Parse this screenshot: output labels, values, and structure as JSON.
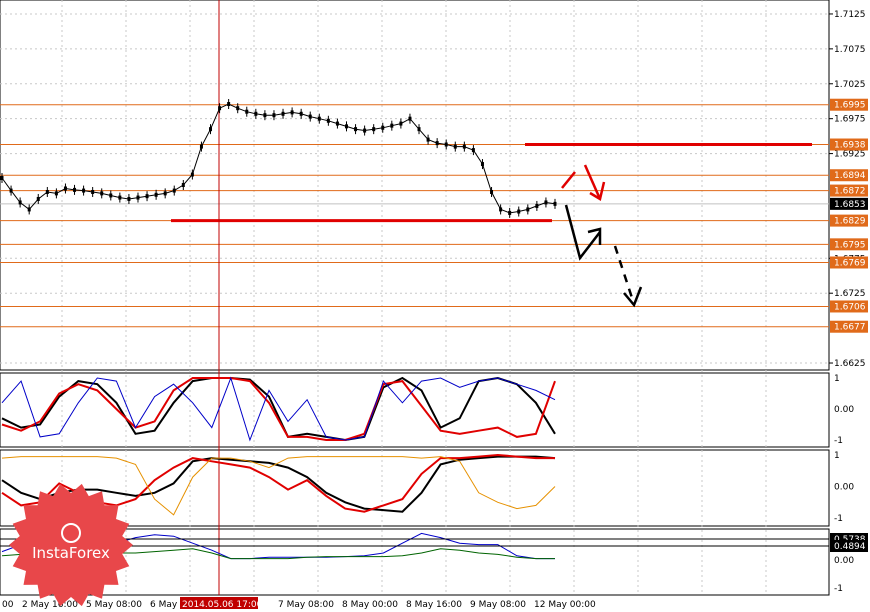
{
  "chart_data": {
    "type": "line",
    "instrument_chart": {
      "price_ticks": [
        "1.7125",
        "1.7075",
        "1.7025",
        "1.6975",
        "1.6925",
        "1.6775",
        "1.6725",
        "1.6625"
      ],
      "ylim": [
        1.6615,
        1.7145
      ],
      "levels": [
        {
          "value": 1.6995,
          "label": "1.6995"
        },
        {
          "value": 1.6938,
          "label": "1.6938"
        },
        {
          "value": 1.6894,
          "label": "1.6894"
        },
        {
          "value": 1.6872,
          "label": "1.6872"
        },
        {
          "value": 1.6829,
          "label": "1.6829"
        },
        {
          "value": 1.6795,
          "label": "1.6795"
        },
        {
          "value": 1.6769,
          "label": "1.6769"
        },
        {
          "value": 1.6706,
          "label": "1.6706"
        },
        {
          "value": 1.6677,
          "label": "1.6677"
        }
      ],
      "current_price": {
        "value": 1.6853,
        "label": "1.6853"
      },
      "resistance_line": {
        "value": 1.6938
      },
      "support_line": {
        "value": 1.6829
      },
      "price_series": [
        1.689,
        1.6872,
        1.6855,
        1.6845,
        1.686,
        1.687,
        1.6868,
        1.6875,
        1.6873,
        1.6872,
        1.687,
        1.6868,
        1.6865,
        1.6862,
        1.686,
        1.6862,
        1.6864,
        1.6866,
        1.6868,
        1.6872,
        1.688,
        1.6895,
        1.6935,
        1.696,
        1.699,
        1.6996,
        1.699,
        1.6985,
        1.6982,
        1.698,
        1.698,
        1.6982,
        1.6984,
        1.6982,
        1.6978,
        1.6975,
        1.6972,
        1.6968,
        1.6964,
        1.696,
        1.6958,
        1.696,
        1.6962,
        1.6965,
        1.6968,
        1.6975,
        1.696,
        1.6945,
        1.694,
        1.6938,
        1.6935,
        1.6935,
        1.693,
        1.691,
        1.687,
        1.6845,
        1.684,
        1.6842,
        1.6845,
        1.685,
        1.6855,
        1.6853
      ]
    },
    "date_labels": [
      "00",
      "2 May 16:00",
      "5 May 08:00",
      "6 May",
      "2014.05.06 17:00",
      "7 May 08:00",
      "8 May 00:00",
      "8 May 16:00",
      "9 May 08:00",
      "12 May 00:00"
    ],
    "highlight_date": "2014.05.06 17:00",
    "indicator1": {
      "ticks": [
        "1",
        "0.00",
        "-1"
      ],
      "ylim": [
        -1,
        1
      ],
      "series": [
        {
          "color": "#000000",
          "values": [
            -0.3,
            -0.6,
            -0.5,
            0.4,
            0.9,
            0.8,
            0.2,
            -0.8,
            -0.7,
            0.2,
            0.9,
            1.0,
            1.0,
            0.95,
            0.4,
            -0.9,
            -0.8,
            -0.9,
            -1.0,
            -0.9,
            0.7,
            1.0,
            0.6,
            -0.6,
            -0.3,
            0.9,
            1.0,
            0.8,
            0.2,
            -0.8
          ]
        },
        {
          "color": "#e00000",
          "values": [
            -0.5,
            -0.7,
            -0.4,
            0.5,
            0.8,
            0.6,
            0.0,
            -0.6,
            -0.4,
            0.6,
            1.0,
            1.0,
            1.0,
            0.9,
            0.2,
            -0.9,
            -0.9,
            -1.0,
            -1.0,
            -0.8,
            0.8,
            0.9,
            0.1,
            -0.7,
            -0.8,
            -0.7,
            -0.6,
            -0.9,
            -0.8,
            0.9
          ]
        },
        {
          "color": "#0000c8",
          "values": [
            0.2,
            0.9,
            -0.9,
            -0.8,
            0.2,
            1.0,
            0.9,
            -0.6,
            0.4,
            0.8,
            0.2,
            -0.6,
            1.0,
            -1.0,
            0.6,
            -0.4,
            0.3,
            -0.9,
            -1.0,
            -0.9,
            0.9,
            0.2,
            0.9,
            1.0,
            0.7,
            0.9,
            1.0,
            0.8,
            0.6,
            0.3
          ]
        }
      ]
    },
    "indicator2": {
      "ticks": [
        "1",
        "0.00",
        "-1"
      ],
      "ylim": [
        -1,
        1
      ],
      "series": [
        {
          "color": "#000000",
          "values": [
            0.2,
            -0.2,
            -0.4,
            -0.2,
            -0.1,
            -0.1,
            -0.2,
            -0.3,
            -0.2,
            0.1,
            0.8,
            0.9,
            0.85,
            0.8,
            0.75,
            0.6,
            0.3,
            -0.2,
            -0.5,
            -0.7,
            -0.75,
            -0.8,
            -0.2,
            0.7,
            0.85,
            0.9,
            0.95,
            0.95,
            0.95,
            0.9
          ]
        },
        {
          "color": "#e00000",
          "values": [
            -0.2,
            -0.6,
            -0.5,
            0.1,
            -0.2,
            -0.5,
            -0.6,
            -0.4,
            0.2,
            0.6,
            0.9,
            0.8,
            0.7,
            0.6,
            0.3,
            -0.1,
            0.2,
            -0.3,
            -0.7,
            -0.8,
            -0.6,
            -0.4,
            0.4,
            0.9,
            0.9,
            0.95,
            1.0,
            0.95,
            0.9,
            0.9
          ]
        },
        {
          "color": "#e69100",
          "values": [
            0.9,
            0.95,
            0.95,
            0.95,
            0.95,
            0.95,
            0.9,
            0.7,
            -0.4,
            -0.9,
            0.3,
            0.9,
            0.9,
            0.8,
            0.6,
            0.9,
            0.95,
            0.95,
            0.95,
            0.95,
            0.95,
            0.95,
            0.9,
            0.95,
            0.8,
            -0.2,
            -0.5,
            -0.7,
            -0.6,
            0.0
          ]
        }
      ]
    },
    "indicator3": {
      "ticks": [
        "0.5738",
        "0.4894",
        "0.00",
        "-1"
      ],
      "ylim": [
        -1,
        1
      ],
      "series": [
        {
          "color": "#0000c8",
          "values": [
            0.3,
            0.55,
            0.45,
            0.4,
            0.45,
            0.5,
            0.6,
            0.8,
            0.9,
            0.85,
            0.6,
            0.35,
            0.05,
            0.05,
            0.1,
            0.1,
            0.1,
            0.1,
            0.12,
            0.15,
            0.25,
            0.6,
            0.95,
            0.8,
            0.6,
            0.55,
            0.55,
            0.15,
            0.05,
            0.05
          ]
        },
        {
          "color": "#006400",
          "values": [
            0.15,
            0.2,
            0.25,
            0.3,
            0.3,
            0.3,
            0.25,
            0.25,
            0.3,
            0.35,
            0.4,
            0.25,
            0.05,
            0.05,
            0.05,
            0.05,
            0.1,
            0.12,
            0.12,
            0.12,
            0.12,
            0.15,
            0.25,
            0.4,
            0.35,
            0.25,
            0.2,
            0.1,
            0.05,
            0.05
          ]
        }
      ]
    }
  },
  "logo": {
    "text": "InstaForex"
  }
}
